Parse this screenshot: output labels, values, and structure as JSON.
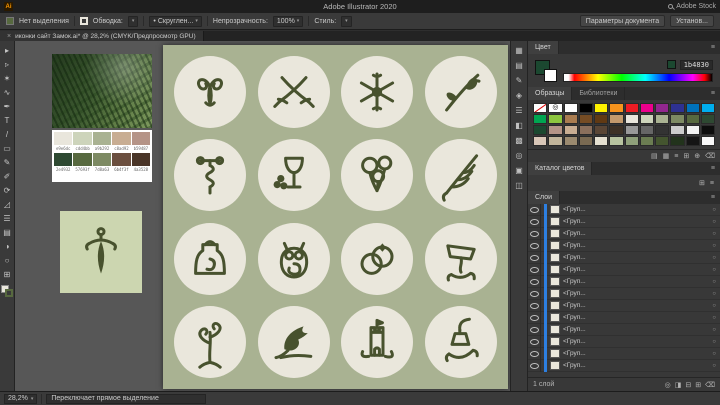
{
  "app": {
    "title": "Adobe Illustrator 2020",
    "stock_label": "Adobe Stock"
  },
  "glyphs": {
    "caret": "▾",
    "close": "×",
    "menu": "≡",
    "bullet": "•"
  },
  "colors": {
    "accent_blue": "#2d7fe0",
    "artboard_green": "#a9b292",
    "circle_cream": "#eae7dc",
    "icon_olive": "#48522e",
    "preview_green": "#ccd6b0",
    "current_hex": "1b4830"
  },
  "control_bar": {
    "no_selection": "Нет выделения",
    "stroke_label": "Обводка:",
    "brush_value": "Скруглен...",
    "opacity_label": "Непрозрачность:",
    "opacity_value": "100%",
    "style_label": "Стиль:",
    "doc_setup": "Параметры документа",
    "preferences": "Установ..."
  },
  "document_tab": {
    "title": "иконки сайт Замок.ai* @ 28,2% (CMYK/Предпросмотр GPU)"
  },
  "tools": [
    {
      "name": "selection-tool",
      "glyph": "▸"
    },
    {
      "name": "direct-selection-tool",
      "glyph": "▹"
    },
    {
      "name": "magic-wand-tool",
      "glyph": "✶"
    },
    {
      "name": "lasso-tool",
      "glyph": "∿"
    },
    {
      "name": "pen-tool",
      "glyph": "✒"
    },
    {
      "name": "type-tool",
      "glyph": "T"
    },
    {
      "name": "line-segment-tool",
      "glyph": "/"
    },
    {
      "name": "rectangle-tool",
      "glyph": "▭"
    },
    {
      "name": "paintbrush-tool",
      "glyph": "✎"
    },
    {
      "name": "pencil-tool",
      "glyph": "✐"
    },
    {
      "name": "rotate-tool",
      "glyph": "⟳"
    },
    {
      "name": "scale-tool",
      "glyph": "◿"
    },
    {
      "name": "width-tool",
      "glyph": "☰"
    },
    {
      "name": "gradient-tool",
      "glyph": "▤"
    },
    {
      "name": "eyedropper-tool",
      "glyph": "◑"
    },
    {
      "name": "zoom-tool",
      "glyph": "○"
    },
    {
      "name": "artboard-tool",
      "glyph": "⊞"
    }
  ],
  "dock_icons": [
    {
      "name": "color-panel-icon",
      "glyph": "▦"
    },
    {
      "name": "swatches-panel-icon",
      "glyph": "▤"
    },
    {
      "name": "brushes-panel-icon",
      "glyph": "✎"
    },
    {
      "name": "symbols-panel-icon",
      "glyph": "◈"
    },
    {
      "name": "stroke-panel-icon",
      "glyph": "☰"
    },
    {
      "name": "gradient-panel-icon",
      "glyph": "◧"
    },
    {
      "name": "transparency-panel-icon",
      "glyph": "▩"
    },
    {
      "name": "appearance-panel-icon",
      "glyph": "◎"
    },
    {
      "name": "graphic-styles-panel-icon",
      "glyph": "▣"
    },
    {
      "name": "libraries-panel-icon",
      "glyph": "◫"
    }
  ],
  "color_panel": {
    "title": "Цвет",
    "hex": "1b4830"
  },
  "swatches_panel": {
    "tabs": [
      "Образцы",
      "Библиотеки"
    ],
    "colors": [
      "none",
      "reg",
      "#ffffff",
      "#000000",
      "#fff200",
      "#f7941d",
      "#ed1c24",
      "#ec008c",
      "#92278f",
      "#2e3192",
      "#0072bc",
      "#00aeef",
      "#00a651",
      "#8dc63f",
      "#a97c50",
      "#754c24",
      "#603913",
      "#c49a6c",
      "#e9e6dc",
      "#cdd4bb",
      "#a9b292",
      "#7d8a63",
      "#57693f",
      "#2e4932",
      "#1b4830",
      "#b59487",
      "#c8ad92",
      "#8a6f5c",
      "#5a4636",
      "#3e3226",
      "#999999",
      "#666666",
      "#333333",
      "#cccccc",
      "#f2f2f2",
      "#0d0d0d",
      "#d9c7b8",
      "#c2b59b",
      "#9b8a6f",
      "#7a6a52",
      "#e5e0d1",
      "#b8c4a0",
      "#8fa07a",
      "#6b7d52",
      "#44552f",
      "#22331c",
      "#151515",
      "#f8f8f8"
    ],
    "footer_icons": [
      {
        "name": "libraries-menu-icon",
        "glyph": "▤"
      },
      {
        "name": "swatch-kinds-icon",
        "glyph": "▦"
      },
      {
        "name": "swatch-options-icon",
        "glyph": "≡"
      },
      {
        "name": "new-color-group-icon",
        "glyph": "⊞"
      },
      {
        "name": "new-swatch-icon",
        "glyph": "⊕"
      },
      {
        "name": "delete-swatch-icon",
        "glyph": "⌫"
      }
    ]
  },
  "catalog_panel": {
    "title": "Каталог цветов",
    "icons": [
      {
        "name": "color-group-icon",
        "glyph": "⊞"
      },
      {
        "name": "catalog-menu-icon",
        "glyph": "≡"
      }
    ]
  },
  "layers_panel": {
    "title": "Слои",
    "rows": [
      {
        "label": "<Груп..."
      },
      {
        "label": "<Груп..."
      },
      {
        "label": "<Груп..."
      },
      {
        "label": "<Груп..."
      },
      {
        "label": "<Груп..."
      },
      {
        "label": "<Груп..."
      },
      {
        "label": "<Груп..."
      },
      {
        "label": "<Груп..."
      },
      {
        "label": "<Груп..."
      },
      {
        "label": "<Груп..."
      },
      {
        "label": "<Груп..."
      },
      {
        "label": "<Груп..."
      },
      {
        "label": "<Груп..."
      },
      {
        "label": "<Груп..."
      }
    ],
    "footer": "1 слой",
    "footer_icons": [
      {
        "name": "locate-object-icon",
        "glyph": "◎"
      },
      {
        "name": "make-mask-icon",
        "glyph": "◨"
      },
      {
        "name": "new-sublayer-icon",
        "glyph": "⊟"
      },
      {
        "name": "new-layer-icon",
        "glyph": "⊞"
      },
      {
        "name": "delete-layer-icon",
        "glyph": "⌫"
      }
    ]
  },
  "palette_card": {
    "rows": [
      [
        {
          "color": "#e9e6dc",
          "code": "e9e6dc"
        },
        {
          "color": "#cdd4bb",
          "code": "cdd4bb"
        },
        {
          "color": "#a9b292",
          "code": "a9b292"
        },
        {
          "color": "#c8ad92",
          "code": "c8ad92"
        },
        {
          "color": "#b59487",
          "code": "b59487"
        }
      ],
      [
        {
          "color": "#2e4932",
          "code": "2e4932"
        },
        {
          "color": "#57693f",
          "code": "57693f"
        },
        {
          "color": "#7d8a63",
          "code": "7d8a63"
        },
        {
          "color": "#6b4f3f",
          "code": "6b4f3f"
        },
        {
          "color": "#4a3528",
          "code": "4a3528"
        }
      ]
    ]
  },
  "artboard": {
    "icons": [
      "ram-ornament",
      "crossed-sabers",
      "snowflake-ornament",
      "leaf-branch",
      "corkscrew",
      "wine-glass-grapes",
      "balloons",
      "feather-quill",
      "apron",
      "owl-ornament",
      "wedding-rings",
      "lamp-sign",
      "swirl-tree",
      "raven",
      "castle-tower",
      "lantern"
    ]
  },
  "preview": {
    "icon": "dagger"
  },
  "status_bar": {
    "zoom": "28,2%",
    "hint": "Переключает прямое выделение"
  }
}
